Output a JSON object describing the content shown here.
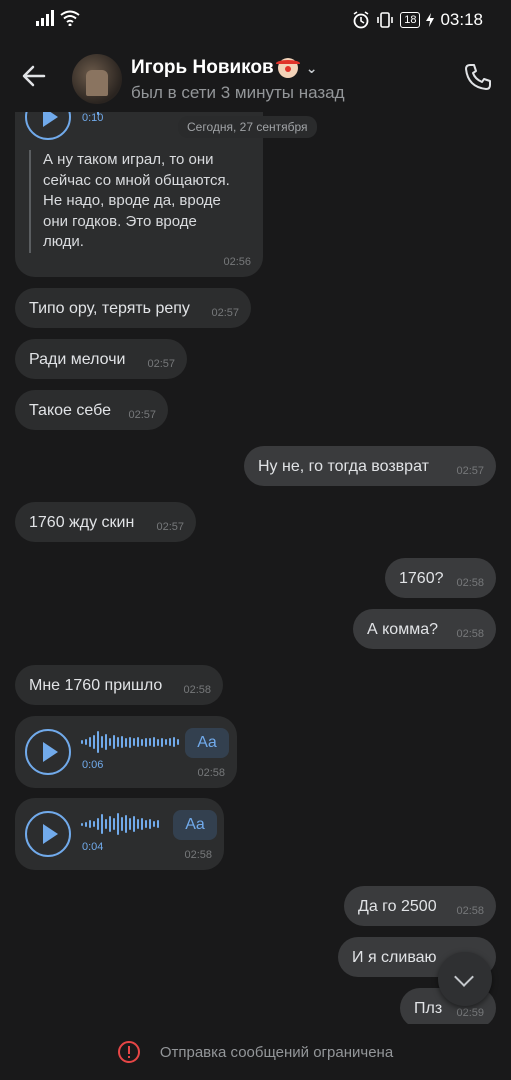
{
  "statusbar": {
    "time": "03:18",
    "battery": "18"
  },
  "header": {
    "name": "Игорь Новиков",
    "status": "был в сети 3 минуты назад"
  },
  "date_chip": "Сегодня, 27 сентября",
  "messages": [
    {
      "partial_voice_duration": "0:10",
      "quote": "А ну таком играл, то они\nсейчас со мной общаются.\nНе надо, вроде да, вроде\nони годков. Это вроде\nлюди.",
      "time": "02:56"
    },
    {
      "text": "Типо ору, терять репу",
      "time": "02:57"
    },
    {
      "text": "Ради мелочи",
      "time": "02:57"
    },
    {
      "text": "Такое себе",
      "time": "02:57"
    },
    {
      "text": "Ну не, го тогда возврат",
      "time": "02:57"
    },
    {
      "text": "1760 жду скин",
      "time": "02:57"
    },
    {
      "text": "1760?",
      "time": "02:58"
    },
    {
      "text": "А комма?",
      "time": "02:58"
    },
    {
      "text": "Мне 1760 пришло",
      "time": "02:58"
    },
    {
      "voice_duration": "0:06",
      "aa": "Aa",
      "time": "02:58"
    },
    {
      "voice_duration": "0:04",
      "aa": "Aa",
      "time": "02:58"
    },
    {
      "text": "Да го 2500",
      "time": "02:58"
    },
    {
      "text": "И я сливаю",
      "time": ""
    },
    {
      "text": "Плз",
      "time": "02:59"
    }
  ],
  "bottom": {
    "restriction": "Отправка сообщений ограничена"
  },
  "colors": {
    "accent": "#71aaeb",
    "background": "#19191a",
    "bubble_in": "#2c2d2e",
    "bubble_out": "#3a3b3d",
    "warning": "#e64646"
  }
}
